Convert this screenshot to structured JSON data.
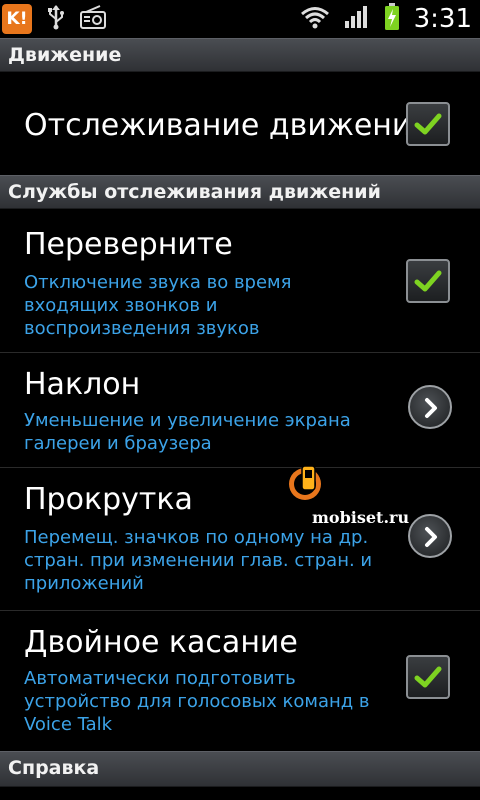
{
  "status_bar": {
    "app_badge": "K!",
    "time": "3:31"
  },
  "sections": {
    "motion_header": "Движение",
    "services_header": "Службы отслеживания движений",
    "help_header": "Справка"
  },
  "settings": {
    "motion_tracking": {
      "title": "Отслеживание движени",
      "checked": true
    },
    "turn_over": {
      "title": "Переверните",
      "desc": "Отключение звука во время входящих звонков и воспроизведения звуков",
      "checked": true
    },
    "tilt": {
      "title": "Наклон",
      "desc": "Уменьшение и увеличение экрана галереи и браузера"
    },
    "scroll": {
      "title": "Прокрутка",
      "desc": "Перемещ. значков по одному на др. стран. при изменении глав. стран. и приложений"
    },
    "double_tap": {
      "title": "Двойное касание",
      "desc": "Автоматически подготовить устройство для голосовых команд в Voice Talk",
      "checked": true
    }
  },
  "watermark": {
    "text": "mobiset.ru"
  },
  "colors": {
    "accent_blue": "#3ca3e8",
    "check_green": "#7ed321",
    "badge_orange": "#e8761c"
  }
}
